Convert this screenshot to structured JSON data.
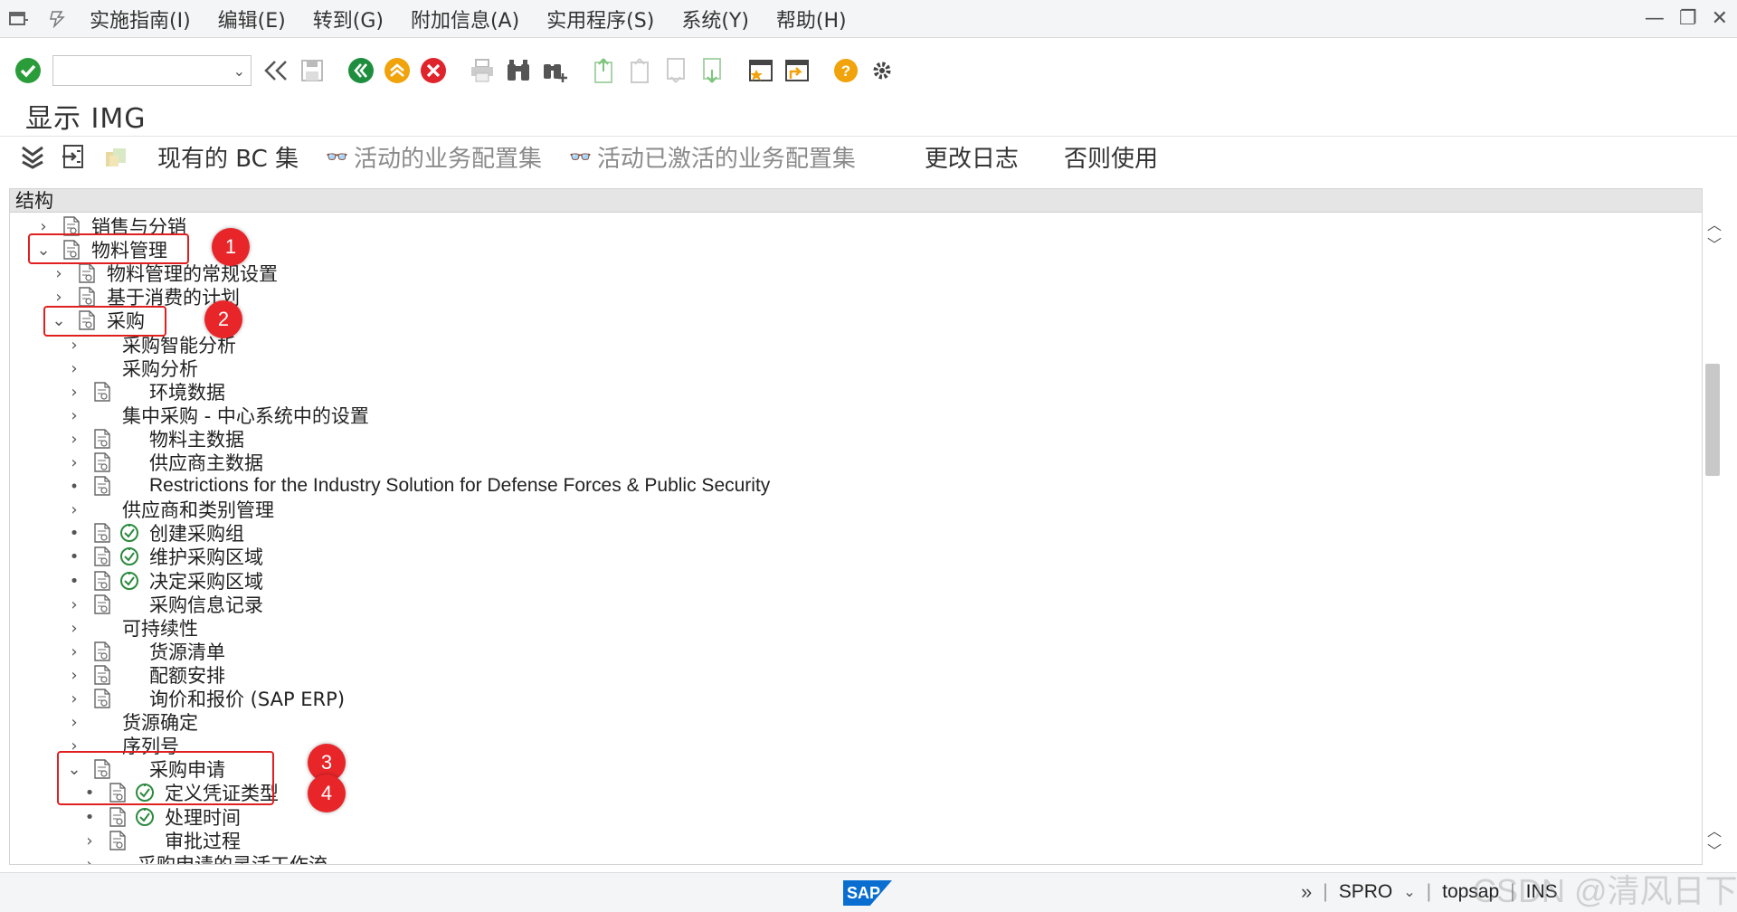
{
  "menubar": {
    "items": [
      "实施指南(I)",
      "编辑(E)",
      "转到(G)",
      "附加信息(A)",
      "实用程序(S)",
      "系统(Y)",
      "帮助(H)"
    ]
  },
  "toolbar": {
    "command_value": "",
    "icons": [
      "enter-icon",
      "back-fast-icon",
      "save-icon",
      "back-icon",
      "exit-icon",
      "cancel-icon",
      "print-icon",
      "find-icon",
      "find-next-icon",
      "first-page-icon",
      "prev-page-icon",
      "next-page-icon",
      "last-page-icon",
      "new-session-icon",
      "shortcut-icon",
      "help-icon",
      "settings-icon"
    ]
  },
  "title": "显示 IMG",
  "app_toolbar": {
    "existing_bc_sets": "现有的 BC 集",
    "active_bc_sets": "活动的业务配置集",
    "activated_bc_sets": "活动已激活的业务配置集",
    "change_log": "更改日志",
    "where_used": "否则使用"
  },
  "tree": {
    "header": "结构",
    "rows": [
      {
        "label": "销售与分销",
        "toggle": "›",
        "icon": true,
        "exec": false
      },
      {
        "label": "物料管理",
        "toggle": "⌄",
        "icon": true,
        "exec": false
      },
      {
        "label": "物料管理的常规设置",
        "toggle": "›",
        "icon": true,
        "exec": false
      },
      {
        "label": "基于消费的计划",
        "toggle": "›",
        "icon": true,
        "exec": false
      },
      {
        "label": "采购",
        "toggle": "⌄",
        "icon": true,
        "exec": false
      },
      {
        "label": "采购智能分析",
        "toggle": "›",
        "icon": false,
        "exec": false
      },
      {
        "label": "采购分析",
        "toggle": "›",
        "icon": false,
        "exec": false
      },
      {
        "label": "环境数据",
        "toggle": "›",
        "icon": true,
        "exec": false
      },
      {
        "label": "集中采购 - 中心系统中的设置",
        "toggle": "›",
        "icon": false,
        "exec": false
      },
      {
        "label": "物料主数据",
        "toggle": "›",
        "icon": true,
        "exec": false
      },
      {
        "label": "供应商主数据",
        "toggle": "›",
        "icon": true,
        "exec": false
      },
      {
        "label": "Restrictions for the Industry Solution for Defense Forces & Public Security",
        "toggle": "•",
        "icon": true,
        "exec": false
      },
      {
        "label": "供应商和类别管理",
        "toggle": "›",
        "icon": false,
        "exec": false
      },
      {
        "label": "创建采购组",
        "toggle": "•",
        "icon": true,
        "exec": true
      },
      {
        "label": "维护采购区域",
        "toggle": "•",
        "icon": true,
        "exec": true
      },
      {
        "label": "决定采购区域",
        "toggle": "•",
        "icon": true,
        "exec": true
      },
      {
        "label": "采购信息记录",
        "toggle": "›",
        "icon": true,
        "exec": false
      },
      {
        "label": "可持续性",
        "toggle": "›",
        "icon": false,
        "exec": false
      },
      {
        "label": "货源清单",
        "toggle": "›",
        "icon": true,
        "exec": false
      },
      {
        "label": "配额安排",
        "toggle": "›",
        "icon": true,
        "exec": false
      },
      {
        "label": "询价和报价 (SAP ERP)",
        "toggle": "›",
        "icon": true,
        "exec": false
      },
      {
        "label": "货源确定",
        "toggle": "›",
        "icon": false,
        "exec": false
      },
      {
        "label": "序列号",
        "toggle": "›",
        "icon": false,
        "exec": false
      },
      {
        "label": "采购申请",
        "toggle": "⌄",
        "icon": true,
        "exec": false
      },
      {
        "label": "定义凭证类型",
        "toggle": "•",
        "icon": true,
        "exec": true
      },
      {
        "label": "处理时间",
        "toggle": "•",
        "icon": true,
        "exec": true
      },
      {
        "label": "审批过程",
        "toggle": "›",
        "icon": true,
        "exec": false
      },
      {
        "label": "采购申请的灵活工作流",
        "toggle": "›",
        "icon": false,
        "exec": false
      }
    ]
  },
  "annotations": [
    "1",
    "2",
    "3",
    "4"
  ],
  "status": {
    "transaction": "SPRO",
    "system": "topsap",
    "mode": "INS"
  },
  "branding": {
    "logo": "SAP",
    "watermark": "CSDN @清风日下"
  }
}
